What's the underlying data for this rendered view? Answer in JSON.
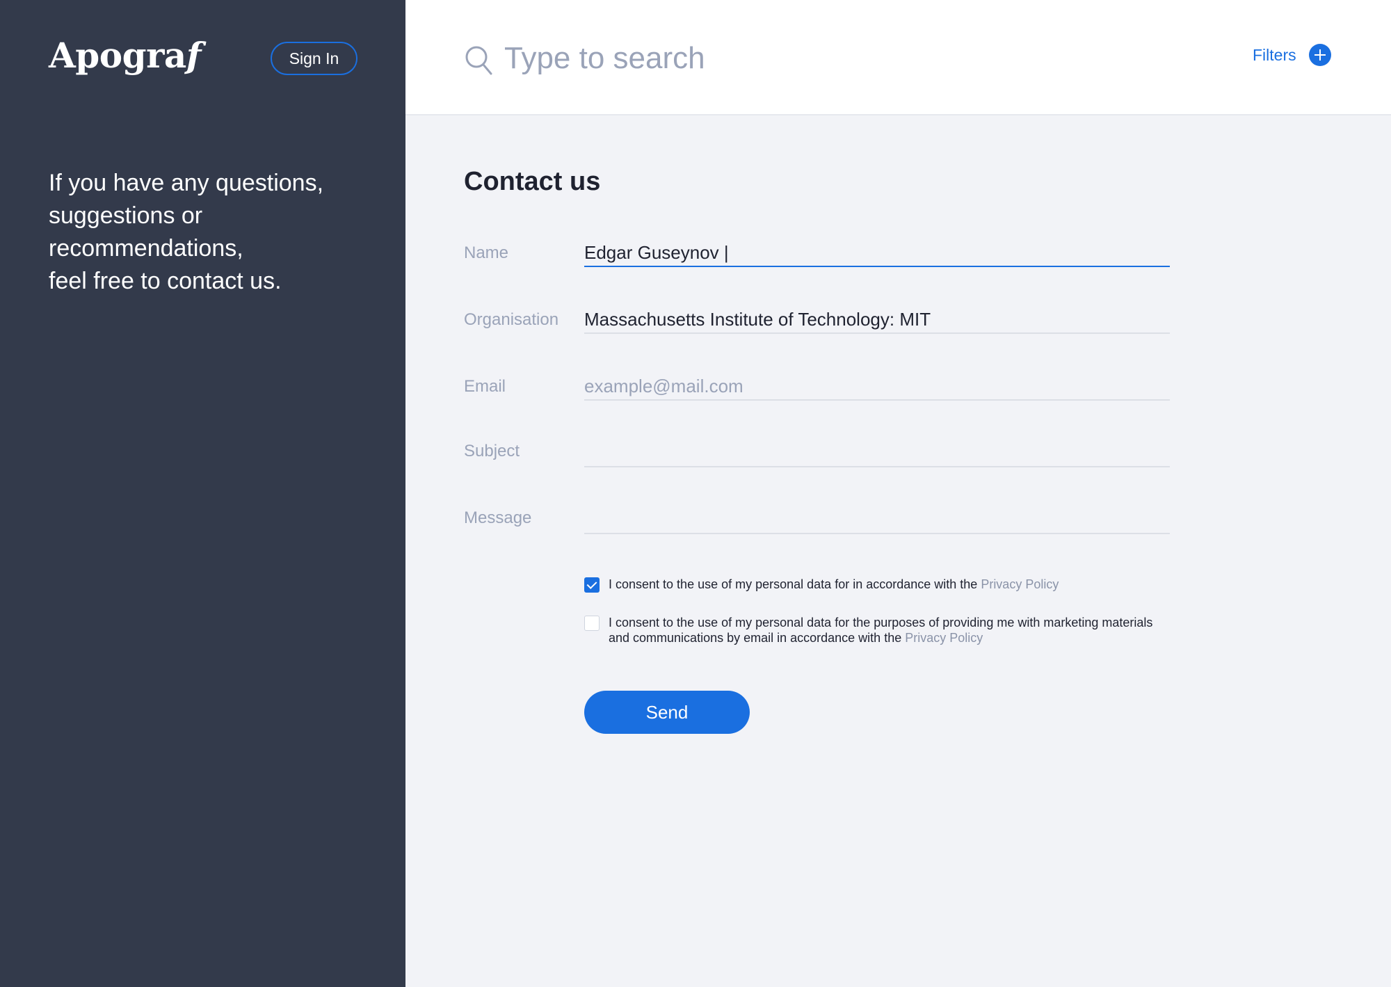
{
  "sidebar": {
    "logo": "Apogra",
    "logo_italic": "f",
    "signin_label": "Sign In",
    "tagline": [
      "If you have any questions,",
      "suggestions or",
      "recommendations,",
      "feel free to contact us."
    ]
  },
  "header": {
    "search_placeholder": "Type to search",
    "filters_label": "Filters"
  },
  "form": {
    "title": "Contact us",
    "fields": [
      {
        "label": "Name",
        "value": "Edgar Guseynov |",
        "placeholder": ""
      },
      {
        "label": "Organisation",
        "value": "Massachusetts Institute of Technology: MIT",
        "placeholder": ""
      },
      {
        "label": "Email",
        "value": "",
        "placeholder": "example@mail.com"
      },
      {
        "label": "Subject",
        "value": "",
        "placeholder": ""
      },
      {
        "label": "Message",
        "value": "",
        "placeholder": ""
      }
    ],
    "consents": [
      {
        "text": "I consent to the use of my personal data for in accordance with the ",
        "link": "Privacy Policy",
        "checked": true
      },
      {
        "text": "I consent to the use of my personal data for the purposes of providing me with marketing materials and communications by email in accordance with the ",
        "link": "Privacy Policy",
        "checked": false
      }
    ],
    "send_label": "Send"
  },
  "colors": {
    "sidebar_bg": "#333a4b",
    "accent": "#1a6fe0",
    "page_bg": "#f2f3f7"
  }
}
